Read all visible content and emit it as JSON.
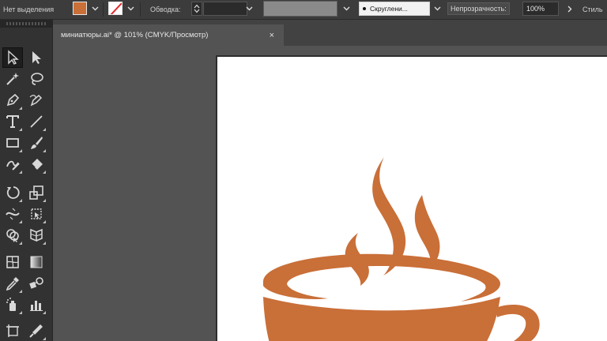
{
  "control_bar": {
    "selection_status": "Нет выделения",
    "stroke_label": "Обводка:",
    "brush": {
      "dot_icon": "round-brush-dot-icon",
      "label": "Скруглени..."
    },
    "opacity_label": "Непрозрачность:",
    "opacity_value": "100%",
    "style_label": "Стиль",
    "colors": {
      "fill": "#c96f38",
      "stroke_none": "#ffffff",
      "none_slash": "#e2262a"
    }
  },
  "document_tab": {
    "title": "миниатюры.ai* @ 101% (CMYK/Просмотр)",
    "close_glyph": "×"
  },
  "tools": [
    "selection-tool",
    "direct-selection-tool",
    "magic-wand-tool",
    "lasso-tool",
    "pen-tool",
    "curvature-tool",
    "type-tool",
    "line-segment-tool",
    "rectangle-tool",
    "paintbrush-tool",
    "shaper-tool",
    "eraser-tool",
    "rotate-tool",
    "scale-tool",
    "width-tool",
    "free-transform-tool",
    "shape-builder-tool",
    "perspective-grid-tool",
    "mesh-tool",
    "gradient-tool",
    "eyedropper-tool",
    "blend-tool",
    "symbol-sprayer-tool",
    "column-graph-tool",
    "artboard-tool",
    "slice-tool"
  ],
  "artwork": {
    "subject": "coffee-cup-logo",
    "color": "#c96f38",
    "background": "#ffffff"
  }
}
